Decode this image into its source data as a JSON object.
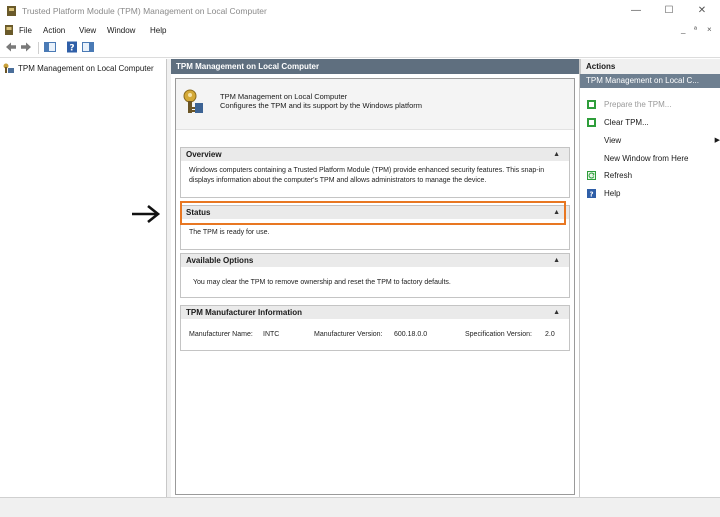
{
  "window": {
    "title": "Trusted Platform Module (TPM) Management on Local Computer",
    "controls": {
      "minimize": "—",
      "maximize": "☐",
      "close": "✕"
    }
  },
  "menubar": {
    "items": [
      "File",
      "Action",
      "View",
      "Window",
      "Help"
    ],
    "mdi_controls": {
      "minimize": "_",
      "restore": "ª",
      "close": "×"
    }
  },
  "tree": {
    "item": "TPM Management on Local Computer"
  },
  "center": {
    "header": "TPM Management on Local Computer",
    "intro": {
      "line1": "TPM Management on Local Computer",
      "line2": "Configures the TPM and its support by the Windows platform"
    },
    "overview": {
      "heading": "Overview",
      "body": "Windows computers containing a Trusted Platform Module (TPM) provide enhanced security features. This snap-in displays information about the computer's TPM and allows administrators to manage the device."
    },
    "status": {
      "heading": "Status",
      "body": "The TPM is ready for use."
    },
    "options": {
      "heading": "Available Options",
      "body": "You may clear the TPM to remove ownership and reset the TPM to factory defaults."
    },
    "manufacturer": {
      "heading": "TPM Manufacturer Information",
      "name_label": "Manufacturer Name:",
      "name_value": "INTC",
      "version_label": "Manufacturer Version:",
      "version_value": "600.18.0.0",
      "spec_label": "Specification Version:",
      "spec_value": "2.0"
    },
    "collapse_glyph": "▲"
  },
  "actions": {
    "header": "Actions",
    "subheader": "TPM Management on Local C...",
    "items": [
      {
        "label": "Prepare the TPM...",
        "icon": "prepare-tpm-icon",
        "enabled": false
      },
      {
        "label": "Clear TPM...",
        "icon": "clear-tpm-icon",
        "enabled": true
      },
      {
        "label": "View",
        "icon": "",
        "enabled": true,
        "submenu": true
      },
      {
        "label": "New Window from Here",
        "icon": "",
        "enabled": true
      },
      {
        "label": "Refresh",
        "icon": "refresh-icon",
        "enabled": true
      },
      {
        "label": "Help",
        "icon": "help-icon",
        "enabled": true
      }
    ]
  },
  "annotation": {
    "arrow": "➔"
  },
  "colors": {
    "highlight_border": "#e87722",
    "header_bg": "#5f6f7f",
    "action_sub_bg": "#6e7f90",
    "action_green": "#2e9e3a"
  }
}
